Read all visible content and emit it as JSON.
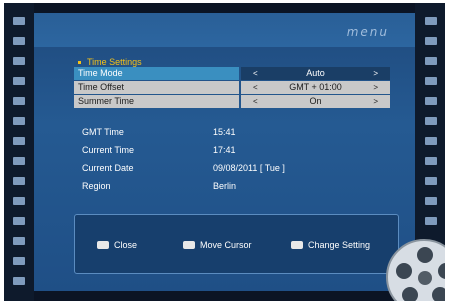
{
  "menu_logo": "menu",
  "title": "Time Settings",
  "settings": [
    {
      "label": "Time Mode",
      "value": "Auto",
      "left_arrow": "<",
      "right_arrow": ">"
    },
    {
      "label": "Time Offset",
      "value": "GMT + 01:00",
      "left_arrow": "<",
      "right_arrow": ">"
    },
    {
      "label": "Summer Time",
      "value": "On",
      "left_arrow": "<",
      "right_arrow": ">"
    }
  ],
  "info": [
    {
      "label": "GMT Time",
      "value": "15:41"
    },
    {
      "label": "Current Time",
      "value": "17:41"
    },
    {
      "label": "Current Date",
      "value": "09/08/2011 [ Tue ]"
    },
    {
      "label": "Region",
      "value": "Berlin"
    }
  ],
  "hints": {
    "close": "Close",
    "move_cursor": "Move Cursor",
    "change_setting": "Change Setting"
  },
  "colors": {
    "accent_title": "#f5c218",
    "active_row": "#3a8fc0",
    "panel": "#255a92"
  }
}
